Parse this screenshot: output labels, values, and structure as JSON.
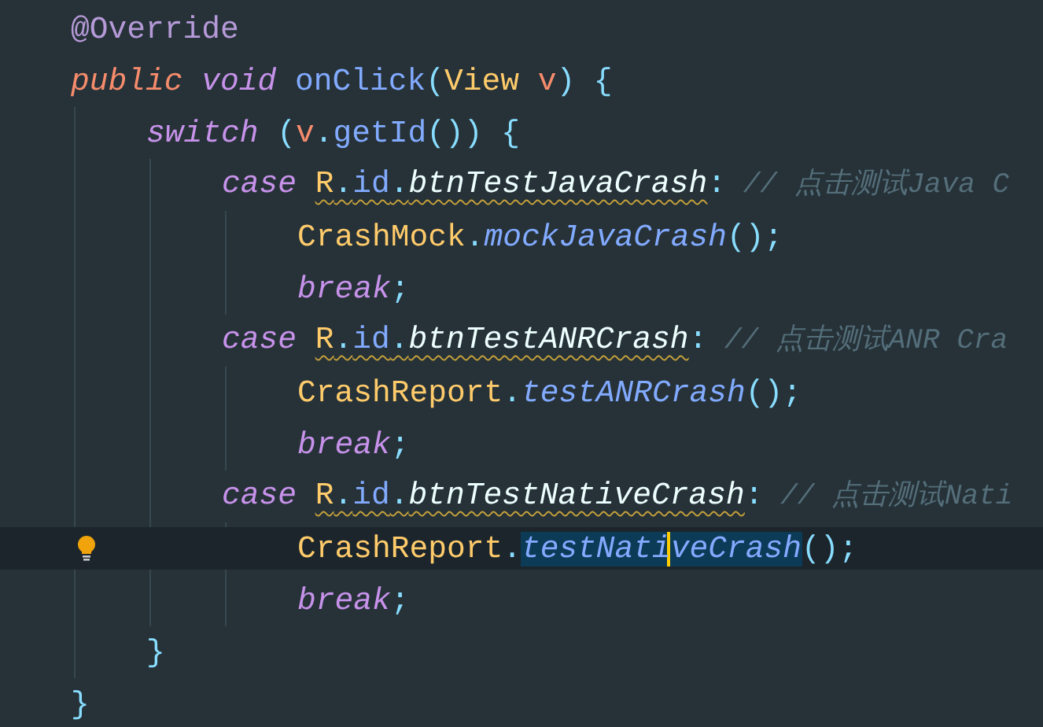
{
  "lines": [
    {
      "tokens": [
        {
          "text": "@Override",
          "kind": "annotation"
        }
      ]
    },
    {
      "tokens": [
        {
          "text": "public ",
          "kind": "modifier"
        },
        {
          "text": "void ",
          "kind": "keyword"
        },
        {
          "text": "onClick",
          "kind": "method"
        },
        {
          "text": "(",
          "kind": "punct"
        },
        {
          "text": "View ",
          "kind": "type"
        },
        {
          "text": "v",
          "kind": "param"
        },
        {
          "text": ") {",
          "kind": "punct"
        }
      ],
      "children": [
        {
          "tokens": [
            {
              "text": "switch",
              "kind": "keyword"
            },
            {
              "text": " (",
              "kind": "punct"
            },
            {
              "text": "v",
              "kind": "param"
            },
            {
              "text": ".",
              "kind": "punct"
            },
            {
              "text": "getId",
              "kind": "method"
            },
            {
              "text": "()) {",
              "kind": "punct"
            }
          ],
          "children": [
            {
              "tokens": [
                {
                  "text": "case ",
                  "kind": "keyword"
                },
                {
                  "text": "R",
                  "kind": "type",
                  "warning": true
                },
                {
                  "text": ".",
                  "kind": "punct",
                  "warning": true
                },
                {
                  "text": "id",
                  "kind": "field",
                  "warning": true
                },
                {
                  "text": ".",
                  "kind": "punct",
                  "warning": true
                },
                {
                  "text": "btnTestJavaCrash",
                  "kind": "constant",
                  "warning": true
                },
                {
                  "text": ":",
                  "kind": "punct"
                },
                {
                  "text": " // 点击测试Java C",
                  "kind": "comment"
                }
              ],
              "children": [
                {
                  "tokens": [
                    {
                      "text": "CrashMock",
                      "kind": "type"
                    },
                    {
                      "text": ".",
                      "kind": "punct"
                    },
                    {
                      "text": "mockJavaCrash",
                      "kind": "static-method"
                    },
                    {
                      "text": "();",
                      "kind": "punct"
                    }
                  ]
                },
                {
                  "tokens": [
                    {
                      "text": "break",
                      "kind": "keyword"
                    },
                    {
                      "text": ";",
                      "kind": "punct"
                    }
                  ]
                }
              ]
            },
            {
              "tokens": [
                {
                  "text": "case ",
                  "kind": "keyword"
                },
                {
                  "text": "R",
                  "kind": "type",
                  "warning": true
                },
                {
                  "text": ".",
                  "kind": "punct",
                  "warning": true
                },
                {
                  "text": "id",
                  "kind": "field",
                  "warning": true
                },
                {
                  "text": ".",
                  "kind": "punct",
                  "warning": true
                },
                {
                  "text": "btnTestANRCrash",
                  "kind": "constant",
                  "warning": true
                },
                {
                  "text": ":",
                  "kind": "punct"
                },
                {
                  "text": " // 点击测试ANR Cra",
                  "kind": "comment"
                }
              ],
              "children": [
                {
                  "tokens": [
                    {
                      "text": "CrashReport",
                      "kind": "type"
                    },
                    {
                      "text": ".",
                      "kind": "punct"
                    },
                    {
                      "text": "testANRCrash",
                      "kind": "static-method"
                    },
                    {
                      "text": "();",
                      "kind": "punct"
                    }
                  ]
                },
                {
                  "tokens": [
                    {
                      "text": "break",
                      "kind": "keyword"
                    },
                    {
                      "text": ";",
                      "kind": "punct"
                    }
                  ]
                }
              ]
            },
            {
              "tokens": [
                {
                  "text": "case ",
                  "kind": "keyword"
                },
                {
                  "text": "R",
                  "kind": "type",
                  "warning": true
                },
                {
                  "text": ".",
                  "kind": "punct",
                  "warning": true
                },
                {
                  "text": "id",
                  "kind": "field",
                  "warning": true
                },
                {
                  "text": ".",
                  "kind": "punct",
                  "warning": true
                },
                {
                  "text": "btnTestNativeCrash",
                  "kind": "constant",
                  "warning": true
                },
                {
                  "text": ":",
                  "kind": "punct"
                },
                {
                  "text": " // 点击测试Nati",
                  "kind": "comment"
                }
              ],
              "children": [
                {
                  "current": true,
                  "bulb": true,
                  "tokens": [
                    {
                      "text": "CrashReport",
                      "kind": "type"
                    },
                    {
                      "text": ".",
                      "kind": "punct"
                    },
                    {
                      "text": "testNati",
                      "kind": "static-method",
                      "selected": true,
                      "caret": true
                    },
                    {
                      "text": "veCrash",
                      "kind": "static-method",
                      "selected": true
                    },
                    {
                      "text": "();",
                      "kind": "punct"
                    }
                  ]
                },
                {
                  "tokens": [
                    {
                      "text": "break",
                      "kind": "keyword"
                    },
                    {
                      "text": ";",
                      "kind": "punct"
                    }
                  ]
                }
              ]
            }
          ]
        },
        {
          "tokens": [
            {
              "text": "}",
              "kind": "punct"
            }
          ]
        }
      ]
    },
    {
      "tokens": [
        {
          "text": "}",
          "kind": "punct"
        }
      ]
    }
  ]
}
